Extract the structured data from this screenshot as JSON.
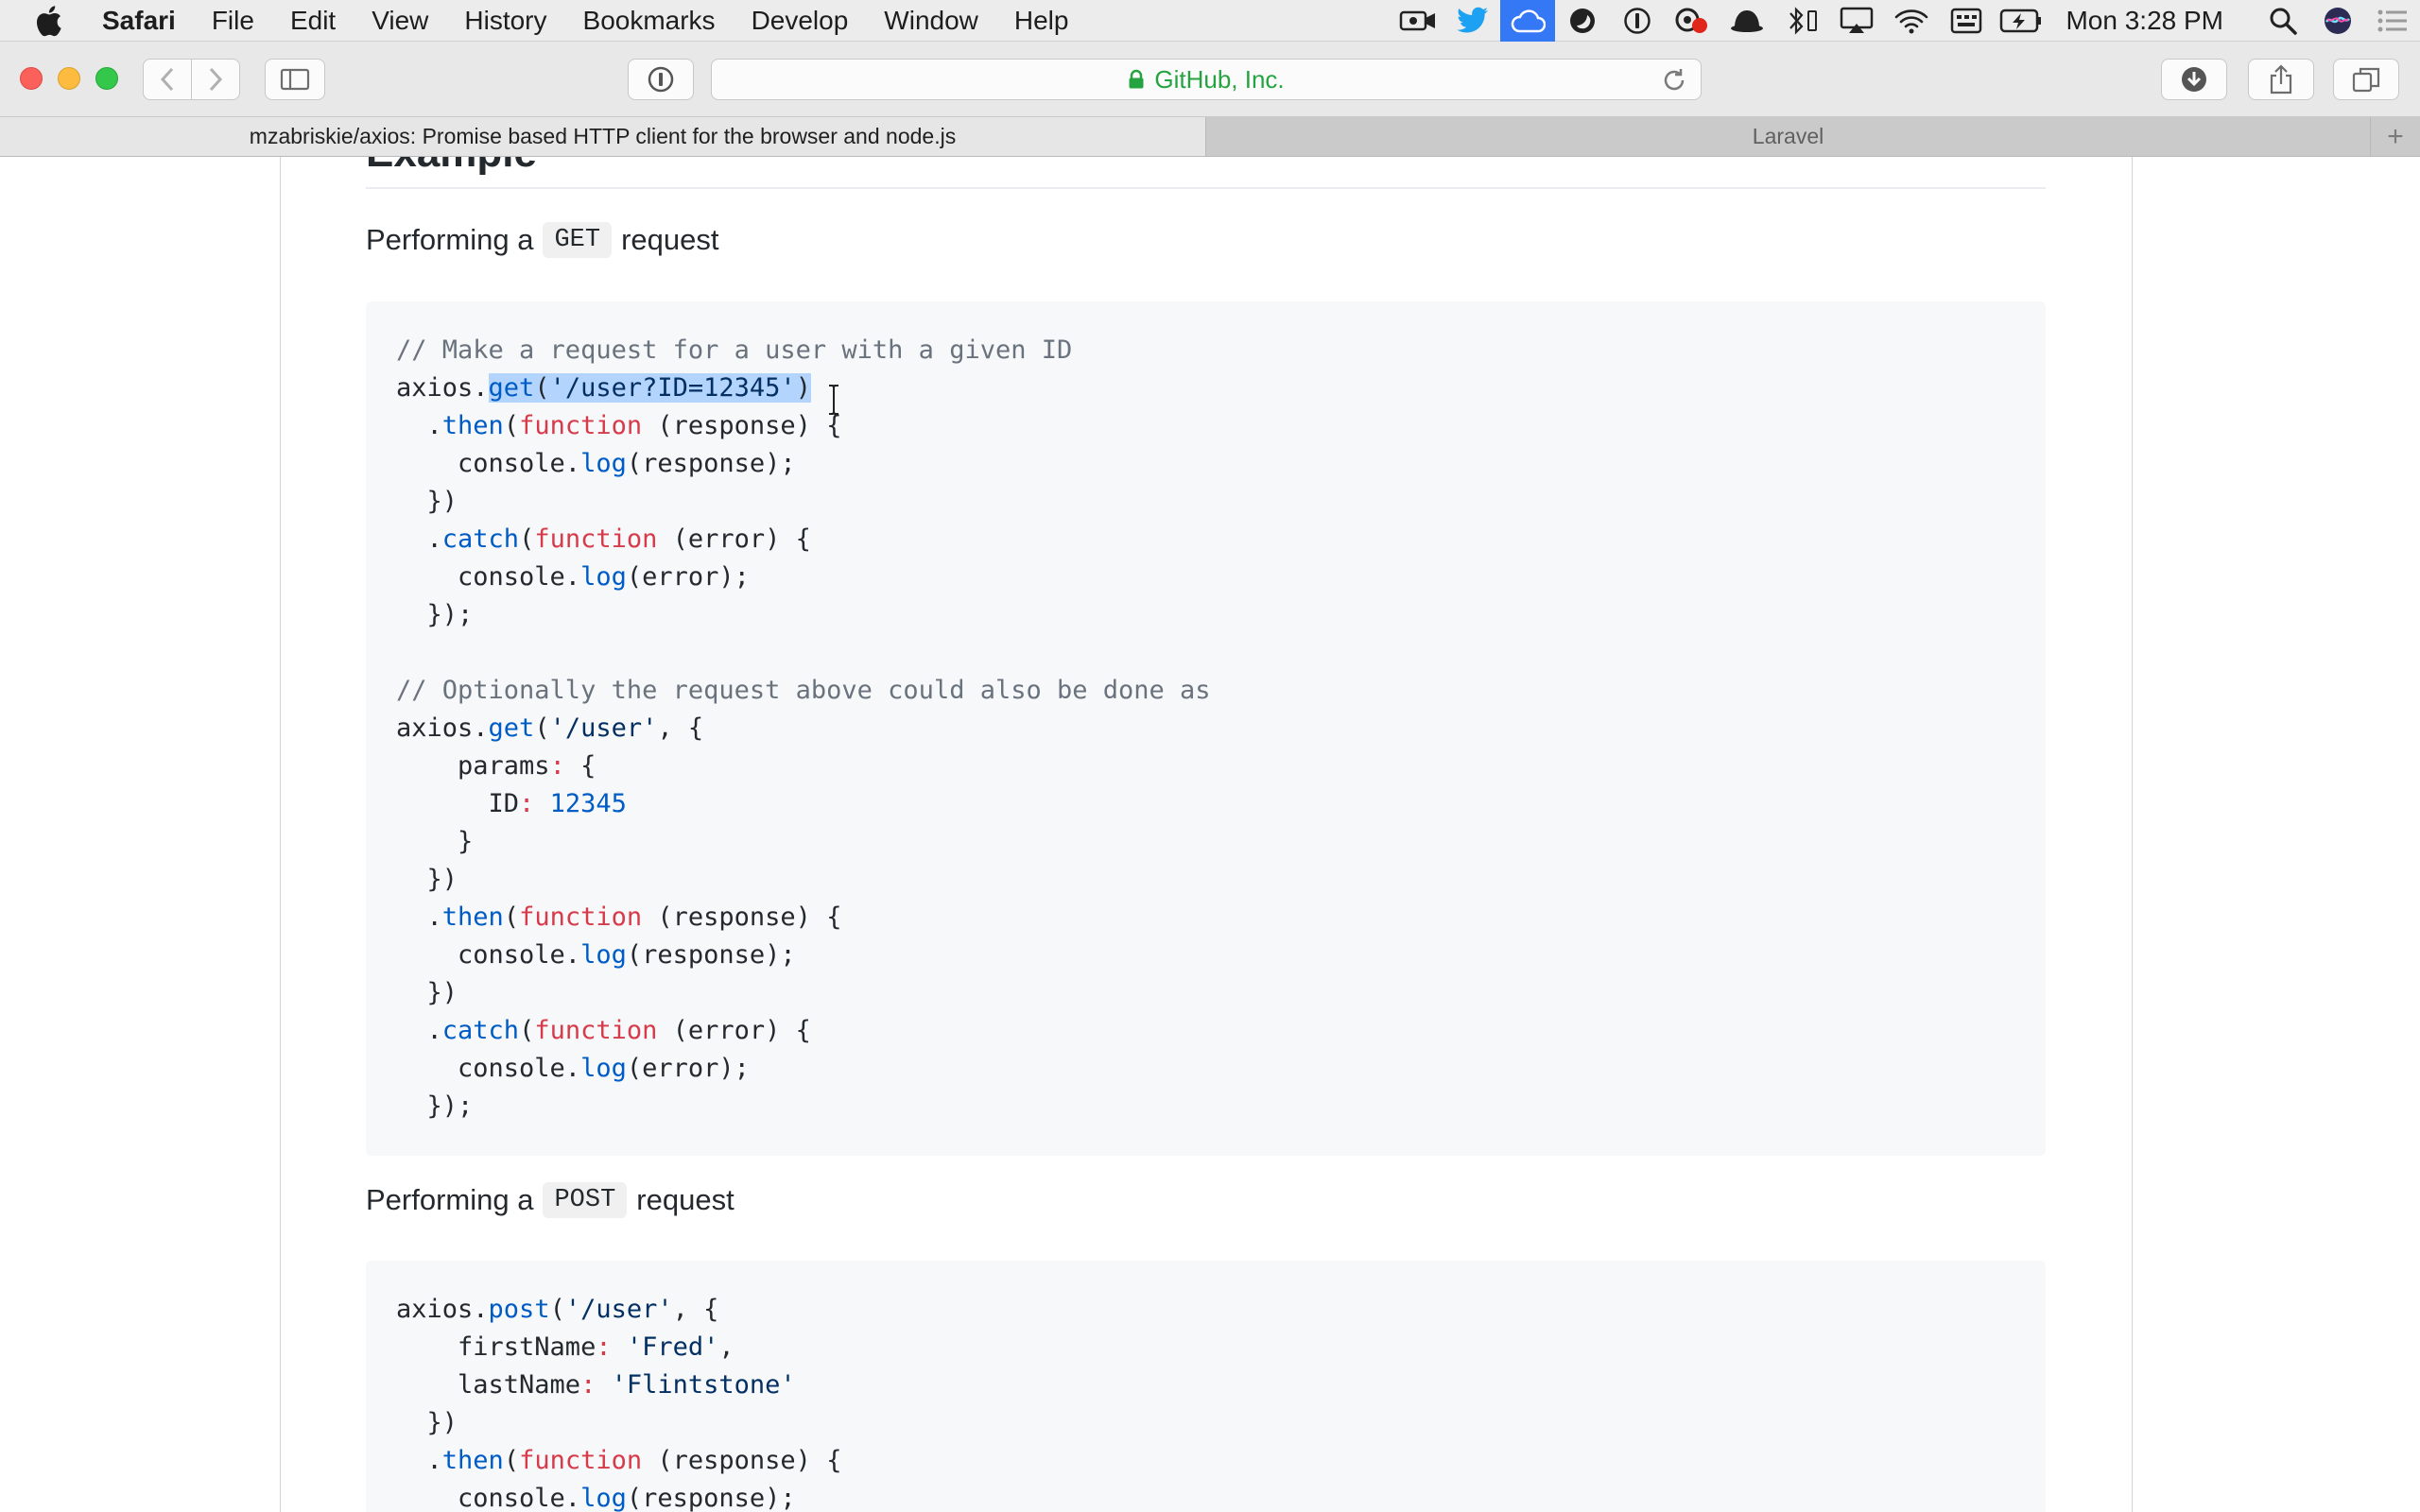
{
  "menubar": {
    "items": [
      "Safari",
      "File",
      "Edit",
      "View",
      "History",
      "Bookmarks",
      "Develop",
      "Window",
      "Help"
    ],
    "clock": "Mon 3:28 PM"
  },
  "toolbar": {
    "url_host": "GitHub, Inc."
  },
  "tabs": [
    {
      "label": "mzabriskie/axios: Promise based HTTP client for the browser and node.js",
      "active": true
    },
    {
      "label": "Laravel",
      "active": false
    }
  ],
  "content": {
    "heading": "Example",
    "get_intro": {
      "before": "Performing a",
      "code": "GET",
      "after": "request"
    },
    "post_intro": {
      "before": "Performing a",
      "code": "POST",
      "after": "request"
    },
    "get_code": [
      [
        [
          "comment",
          "// Make a request for a user with a given ID"
        ]
      ],
      [
        [
          "plain",
          "axios."
        ],
        [
          "fn-sel",
          "get"
        ],
        [
          "plain-sel",
          "("
        ],
        [
          "str-sel",
          "'/user?ID=12345'"
        ],
        [
          "plain-sel",
          ")"
        ]
      ],
      [
        [
          "plain",
          "  ."
        ],
        [
          "fn",
          "then"
        ],
        [
          "plain",
          "("
        ],
        [
          "key",
          "function"
        ],
        [
          "plain",
          " (response) {"
        ]
      ],
      [
        [
          "plain",
          "    console."
        ],
        [
          "fn",
          "log"
        ],
        [
          "plain",
          "(response);"
        ]
      ],
      [
        [
          "plain",
          "  })"
        ]
      ],
      [
        [
          "plain",
          "  ."
        ],
        [
          "fn",
          "catch"
        ],
        [
          "plain",
          "("
        ],
        [
          "key",
          "function"
        ],
        [
          "plain",
          " (error) {"
        ]
      ],
      [
        [
          "plain",
          "    console."
        ],
        [
          "fn",
          "log"
        ],
        [
          "plain",
          "(error);"
        ]
      ],
      [
        [
          "plain",
          "  });"
        ]
      ],
      [
        [
          "plain",
          ""
        ]
      ],
      [
        [
          "comment",
          "// Optionally the request above could also be done as"
        ]
      ],
      [
        [
          "plain",
          "axios."
        ],
        [
          "fn",
          "get"
        ],
        [
          "plain",
          "("
        ],
        [
          "str",
          "'/user'"
        ],
        [
          "plain",
          ", {"
        ]
      ],
      [
        [
          "plain",
          "    params"
        ],
        [
          "key",
          ":"
        ],
        [
          "plain",
          " {"
        ]
      ],
      [
        [
          "plain",
          "      ID"
        ],
        [
          "key",
          ":"
        ],
        [
          "plain",
          " "
        ],
        [
          "num",
          "12345"
        ]
      ],
      [
        [
          "plain",
          "    }"
        ]
      ],
      [
        [
          "plain",
          "  })"
        ]
      ],
      [
        [
          "plain",
          "  ."
        ],
        [
          "fn",
          "then"
        ],
        [
          "plain",
          "("
        ],
        [
          "key",
          "function"
        ],
        [
          "plain",
          " (response) {"
        ]
      ],
      [
        [
          "plain",
          "    console."
        ],
        [
          "fn",
          "log"
        ],
        [
          "plain",
          "(response);"
        ]
      ],
      [
        [
          "plain",
          "  })"
        ]
      ],
      [
        [
          "plain",
          "  ."
        ],
        [
          "fn",
          "catch"
        ],
        [
          "plain",
          "("
        ],
        [
          "key",
          "function"
        ],
        [
          "plain",
          " (error) {"
        ]
      ],
      [
        [
          "plain",
          "    console."
        ],
        [
          "fn",
          "log"
        ],
        [
          "plain",
          "(error);"
        ]
      ],
      [
        [
          "plain",
          "  });"
        ]
      ]
    ],
    "post_code": [
      [
        [
          "plain",
          "axios."
        ],
        [
          "fn",
          "post"
        ],
        [
          "plain",
          "("
        ],
        [
          "str",
          "'/user'"
        ],
        [
          "plain",
          ", {"
        ]
      ],
      [
        [
          "plain",
          "    firstName"
        ],
        [
          "key",
          ":"
        ],
        [
          "plain",
          " "
        ],
        [
          "str",
          "'Fred'"
        ],
        [
          "plain",
          ","
        ]
      ],
      [
        [
          "plain",
          "    lastName"
        ],
        [
          "key",
          ":"
        ],
        [
          "plain",
          " "
        ],
        [
          "str",
          "'Flintstone'"
        ]
      ],
      [
        [
          "plain",
          "  })"
        ]
      ],
      [
        [
          "plain",
          "  ."
        ],
        [
          "fn",
          "then"
        ],
        [
          "plain",
          "("
        ],
        [
          "key",
          "function"
        ],
        [
          "plain",
          " (response) {"
        ]
      ],
      [
        [
          "plain",
          "    console."
        ],
        [
          "fn",
          "log"
        ],
        [
          "plain",
          "(response);"
        ]
      ]
    ]
  }
}
